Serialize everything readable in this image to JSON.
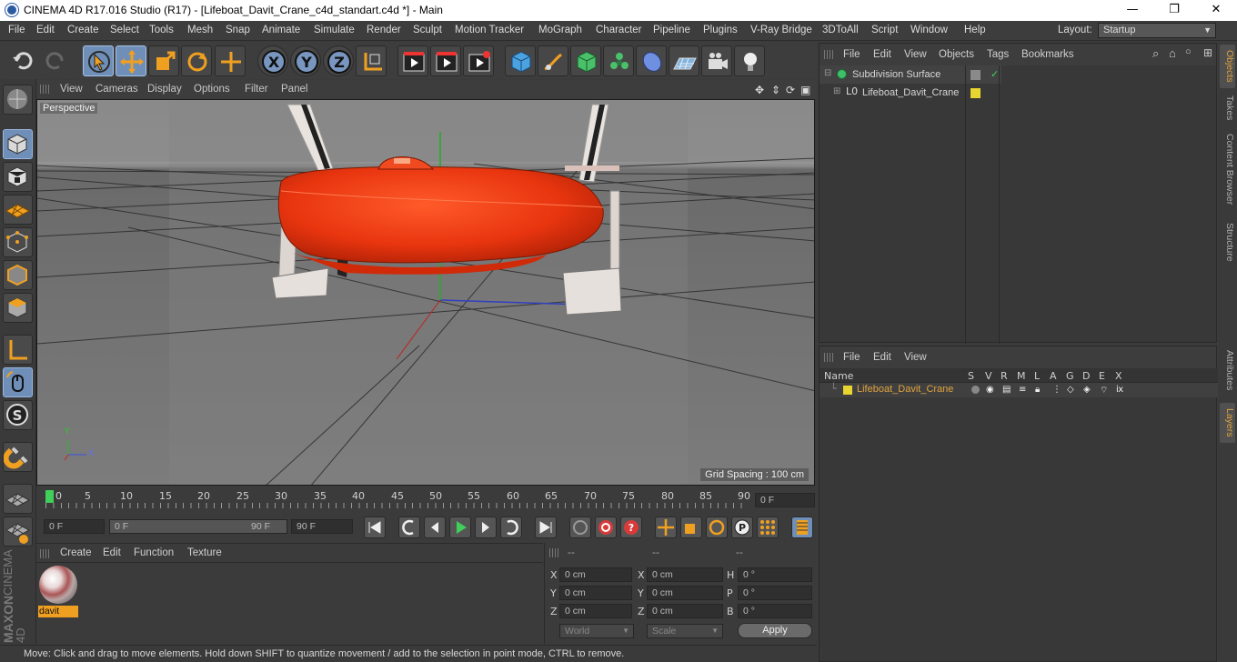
{
  "window": {
    "title": "CINEMA 4D R17.016 Studio (R17) - [Lifeboat_Davit_Crane_c4d_standart.c4d *] - Main",
    "minimize": "—",
    "maximize": "❐",
    "close": "✕"
  },
  "menu": [
    "File",
    "Edit",
    "Create",
    "Select",
    "Tools",
    "Mesh",
    "Snap",
    "Animate",
    "Simulate",
    "Render",
    "Sculpt",
    "Motion Tracker",
    "MoGraph",
    "Character",
    "Pipeline",
    "Plugins",
    "V-Ray Bridge",
    "3DToAll",
    "Script",
    "Window",
    "Help"
  ],
  "layout": {
    "label": "Layout:",
    "value": "Startup"
  },
  "viewport": {
    "menu": [
      "View",
      "Cameras",
      "Display",
      "Options",
      "Filter",
      "Panel"
    ],
    "label": "Perspective",
    "grid_spacing": "Grid Spacing : 100 cm",
    "axis_y": "Y",
    "axis_x": "X",
    "axis_z": "Z"
  },
  "timeline": {
    "ticks": [
      "0",
      "5",
      "10",
      "15",
      "20",
      "25",
      "30",
      "35",
      "40",
      "45",
      "50",
      "55",
      "60",
      "65",
      "70",
      "75",
      "80",
      "85",
      "90"
    ],
    "current": "0 F"
  },
  "transport": {
    "start": "0 F",
    "range_start": "0 F",
    "range_end": "90 F",
    "end": "90 F"
  },
  "material": {
    "menu": [
      "Create",
      "Edit",
      "Function",
      "Texture"
    ],
    "name": "davit"
  },
  "coords": {
    "headers": [
      "--",
      "--",
      "--"
    ],
    "rows": [
      {
        "a": "X",
        "av": "0 cm",
        "b": "X",
        "bv": "0 cm",
        "c": "H",
        "cv": "0 °"
      },
      {
        "a": "Y",
        "av": "0 cm",
        "b": "Y",
        "bv": "0 cm",
        "c": "P",
        "cv": "0 °"
      },
      {
        "a": "Z",
        "av": "0 cm",
        "b": "Z",
        "bv": "0 cm",
        "c": "B",
        "cv": "0 °"
      }
    ],
    "world": "World",
    "scale": "Scale",
    "apply": "Apply"
  },
  "status": "Move: Click and drag to move elements. Hold down SHIFT to quantize movement / add to the selection in point mode, CTRL to remove.",
  "objects": {
    "menu": [
      "File",
      "Edit",
      "View",
      "Objects",
      "Tags",
      "Bookmarks"
    ],
    "items": [
      "Subdivision Surface",
      "Lifeboat_Davit_Crane"
    ]
  },
  "layers": {
    "menu": [
      "File",
      "Edit",
      "View"
    ],
    "columns": [
      "Name",
      "S",
      "V",
      "R",
      "M",
      "L",
      "A",
      "G",
      "D",
      "E",
      "X"
    ],
    "row": "Lifeboat_Davit_Crane"
  },
  "sidetabs": [
    "Objects",
    "Takes",
    "Content Browser",
    "Structure",
    "Attributes",
    "Layers"
  ],
  "brand": {
    "maxon": "MAXON",
    "product": "CINEMA 4D"
  },
  "colors": {
    "accent": "#e2a33d",
    "selection": "#6f8fb8",
    "boat": "#e8350f"
  }
}
